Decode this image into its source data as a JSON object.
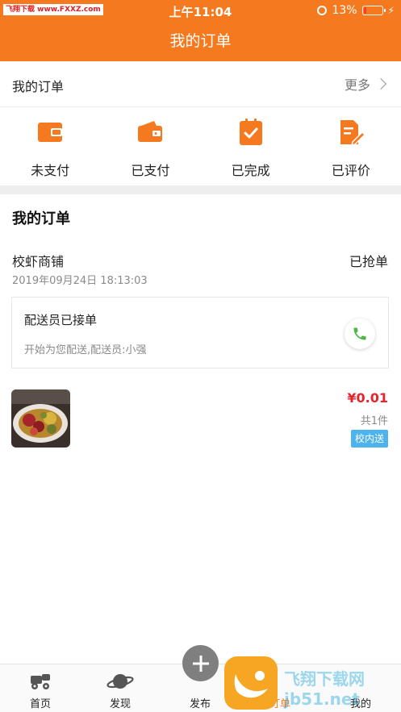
{
  "status_bar": {
    "watermark": "飞翔下载 www.FXXZ.com",
    "time": "上午11:04",
    "battery": "13%",
    "battery_level": 0.13
  },
  "nav": {
    "title": "我的订单"
  },
  "orders_header": {
    "title": "我的订单",
    "more": "更多"
  },
  "status_tabs": [
    {
      "label": "未支付",
      "icon": "wallet-icon"
    },
    {
      "label": "已支付",
      "icon": "wallet-open-icon"
    },
    {
      "label": "已完成",
      "icon": "clipboard-check-icon"
    },
    {
      "label": "已评价",
      "icon": "document-edit-icon"
    }
  ],
  "section": {
    "title": "我的订单"
  },
  "order": {
    "shop": "校虾商铺",
    "status": "已抢单",
    "time": "2019年09月24日 18:13:03",
    "delivery": {
      "title": "配送员已接单",
      "subtitle": "开始为您配送,配送员:小强",
      "icon": "phone-icon"
    },
    "price": "¥0.01",
    "quantity": "共1件",
    "tag": "校内送"
  },
  "tabbar": [
    {
      "label": "首页",
      "icon": "home-icon"
    },
    {
      "label": "发现",
      "icon": "planet-icon"
    },
    {
      "label": "发布",
      "icon": "plus-icon"
    },
    {
      "label": "订单",
      "icon": "order-icon"
    },
    {
      "label": "我的",
      "icon": "user-icon"
    }
  ],
  "colors": {
    "brand": "#f57a1f",
    "price": "#e8232c",
    "tag": "#4db3ee",
    "phone": "#4cb944"
  },
  "overlay_watermark": "飞翔下载网 jb51.net"
}
